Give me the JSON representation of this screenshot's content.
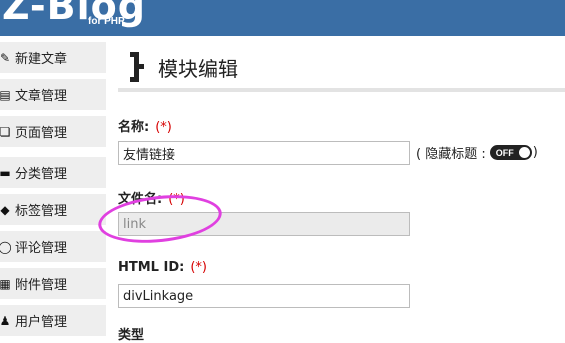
{
  "header": {
    "logo": "Z-Blog",
    "logo_sub": "for PHP"
  },
  "sidebar": {
    "items": [
      {
        "label": "新建文章",
        "icon": "pencil-icon"
      },
      {
        "label": "文章管理",
        "icon": "article-icon"
      },
      {
        "label": "页面管理",
        "icon": "pages-icon"
      },
      {
        "label": "分类管理",
        "icon": "folder-icon"
      },
      {
        "label": "标签管理",
        "icon": "tag-icon"
      },
      {
        "label": "评论管理",
        "icon": "comment-icon"
      },
      {
        "label": "附件管理",
        "icon": "attachment-icon"
      },
      {
        "label": "用户管理",
        "icon": "user-icon"
      }
    ]
  },
  "main": {
    "title": "模块编辑",
    "form": {
      "name": {
        "label": "名称:",
        "required_mark": "(*)",
        "value": "友情链接"
      },
      "hide_title": {
        "prefix": "( 隐藏标题 :",
        "toggle_label": "OFF",
        "suffix": ")"
      },
      "filename": {
        "label": "文件名:",
        "required_mark": "(*)",
        "value": "link"
      },
      "html_id": {
        "label": "HTML ID:",
        "required_mark": "(*)",
        "value": "divLinkage"
      },
      "type": {
        "label": "类型"
      }
    }
  },
  "colors": {
    "header_bg": "#3a6ea5",
    "required": "#d60000",
    "annotation": "#e040e0",
    "sidebar_item_bg": "#eeeeee"
  }
}
